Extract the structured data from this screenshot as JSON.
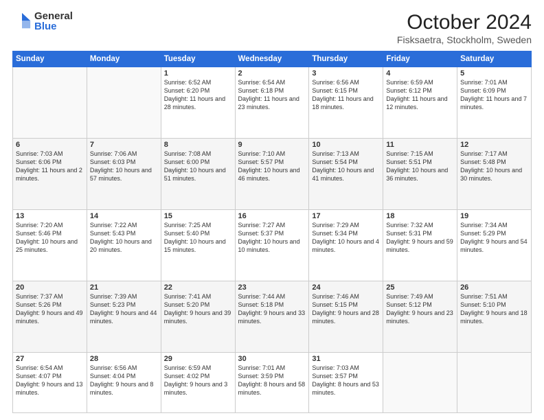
{
  "header": {
    "logo_general": "General",
    "logo_blue": "Blue",
    "month_title": "October 2024",
    "location": "Fisksaetra, Stockholm, Sweden"
  },
  "weekdays": [
    "Sunday",
    "Monday",
    "Tuesday",
    "Wednesday",
    "Thursday",
    "Friday",
    "Saturday"
  ],
  "weeks": [
    [
      {
        "day": "",
        "info": ""
      },
      {
        "day": "",
        "info": ""
      },
      {
        "day": "1",
        "info": "Sunrise: 6:52 AM\nSunset: 6:20 PM\nDaylight: 11 hours and 28 minutes."
      },
      {
        "day": "2",
        "info": "Sunrise: 6:54 AM\nSunset: 6:18 PM\nDaylight: 11 hours and 23 minutes."
      },
      {
        "day": "3",
        "info": "Sunrise: 6:56 AM\nSunset: 6:15 PM\nDaylight: 11 hours and 18 minutes."
      },
      {
        "day": "4",
        "info": "Sunrise: 6:59 AM\nSunset: 6:12 PM\nDaylight: 11 hours and 12 minutes."
      },
      {
        "day": "5",
        "info": "Sunrise: 7:01 AM\nSunset: 6:09 PM\nDaylight: 11 hours and 7 minutes."
      }
    ],
    [
      {
        "day": "6",
        "info": "Sunrise: 7:03 AM\nSunset: 6:06 PM\nDaylight: 11 hours and 2 minutes."
      },
      {
        "day": "7",
        "info": "Sunrise: 7:06 AM\nSunset: 6:03 PM\nDaylight: 10 hours and 57 minutes."
      },
      {
        "day": "8",
        "info": "Sunrise: 7:08 AM\nSunset: 6:00 PM\nDaylight: 10 hours and 51 minutes."
      },
      {
        "day": "9",
        "info": "Sunrise: 7:10 AM\nSunset: 5:57 PM\nDaylight: 10 hours and 46 minutes."
      },
      {
        "day": "10",
        "info": "Sunrise: 7:13 AM\nSunset: 5:54 PM\nDaylight: 10 hours and 41 minutes."
      },
      {
        "day": "11",
        "info": "Sunrise: 7:15 AM\nSunset: 5:51 PM\nDaylight: 10 hours and 36 minutes."
      },
      {
        "day": "12",
        "info": "Sunrise: 7:17 AM\nSunset: 5:48 PM\nDaylight: 10 hours and 30 minutes."
      }
    ],
    [
      {
        "day": "13",
        "info": "Sunrise: 7:20 AM\nSunset: 5:46 PM\nDaylight: 10 hours and 25 minutes."
      },
      {
        "day": "14",
        "info": "Sunrise: 7:22 AM\nSunset: 5:43 PM\nDaylight: 10 hours and 20 minutes."
      },
      {
        "day": "15",
        "info": "Sunrise: 7:25 AM\nSunset: 5:40 PM\nDaylight: 10 hours and 15 minutes."
      },
      {
        "day": "16",
        "info": "Sunrise: 7:27 AM\nSunset: 5:37 PM\nDaylight: 10 hours and 10 minutes."
      },
      {
        "day": "17",
        "info": "Sunrise: 7:29 AM\nSunset: 5:34 PM\nDaylight: 10 hours and 4 minutes."
      },
      {
        "day": "18",
        "info": "Sunrise: 7:32 AM\nSunset: 5:31 PM\nDaylight: 9 hours and 59 minutes."
      },
      {
        "day": "19",
        "info": "Sunrise: 7:34 AM\nSunset: 5:29 PM\nDaylight: 9 hours and 54 minutes."
      }
    ],
    [
      {
        "day": "20",
        "info": "Sunrise: 7:37 AM\nSunset: 5:26 PM\nDaylight: 9 hours and 49 minutes."
      },
      {
        "day": "21",
        "info": "Sunrise: 7:39 AM\nSunset: 5:23 PM\nDaylight: 9 hours and 44 minutes."
      },
      {
        "day": "22",
        "info": "Sunrise: 7:41 AM\nSunset: 5:20 PM\nDaylight: 9 hours and 39 minutes."
      },
      {
        "day": "23",
        "info": "Sunrise: 7:44 AM\nSunset: 5:18 PM\nDaylight: 9 hours and 33 minutes."
      },
      {
        "day": "24",
        "info": "Sunrise: 7:46 AM\nSunset: 5:15 PM\nDaylight: 9 hours and 28 minutes."
      },
      {
        "day": "25",
        "info": "Sunrise: 7:49 AM\nSunset: 5:12 PM\nDaylight: 9 hours and 23 minutes."
      },
      {
        "day": "26",
        "info": "Sunrise: 7:51 AM\nSunset: 5:10 PM\nDaylight: 9 hours and 18 minutes."
      }
    ],
    [
      {
        "day": "27",
        "info": "Sunrise: 6:54 AM\nSunset: 4:07 PM\nDaylight: 9 hours and 13 minutes."
      },
      {
        "day": "28",
        "info": "Sunrise: 6:56 AM\nSunset: 4:04 PM\nDaylight: 9 hours and 8 minutes."
      },
      {
        "day": "29",
        "info": "Sunrise: 6:59 AM\nSunset: 4:02 PM\nDaylight: 9 hours and 3 minutes."
      },
      {
        "day": "30",
        "info": "Sunrise: 7:01 AM\nSunset: 3:59 PM\nDaylight: 8 hours and 58 minutes."
      },
      {
        "day": "31",
        "info": "Sunrise: 7:03 AM\nSunset: 3:57 PM\nDaylight: 8 hours and 53 minutes."
      },
      {
        "day": "",
        "info": ""
      },
      {
        "day": "",
        "info": ""
      }
    ]
  ]
}
